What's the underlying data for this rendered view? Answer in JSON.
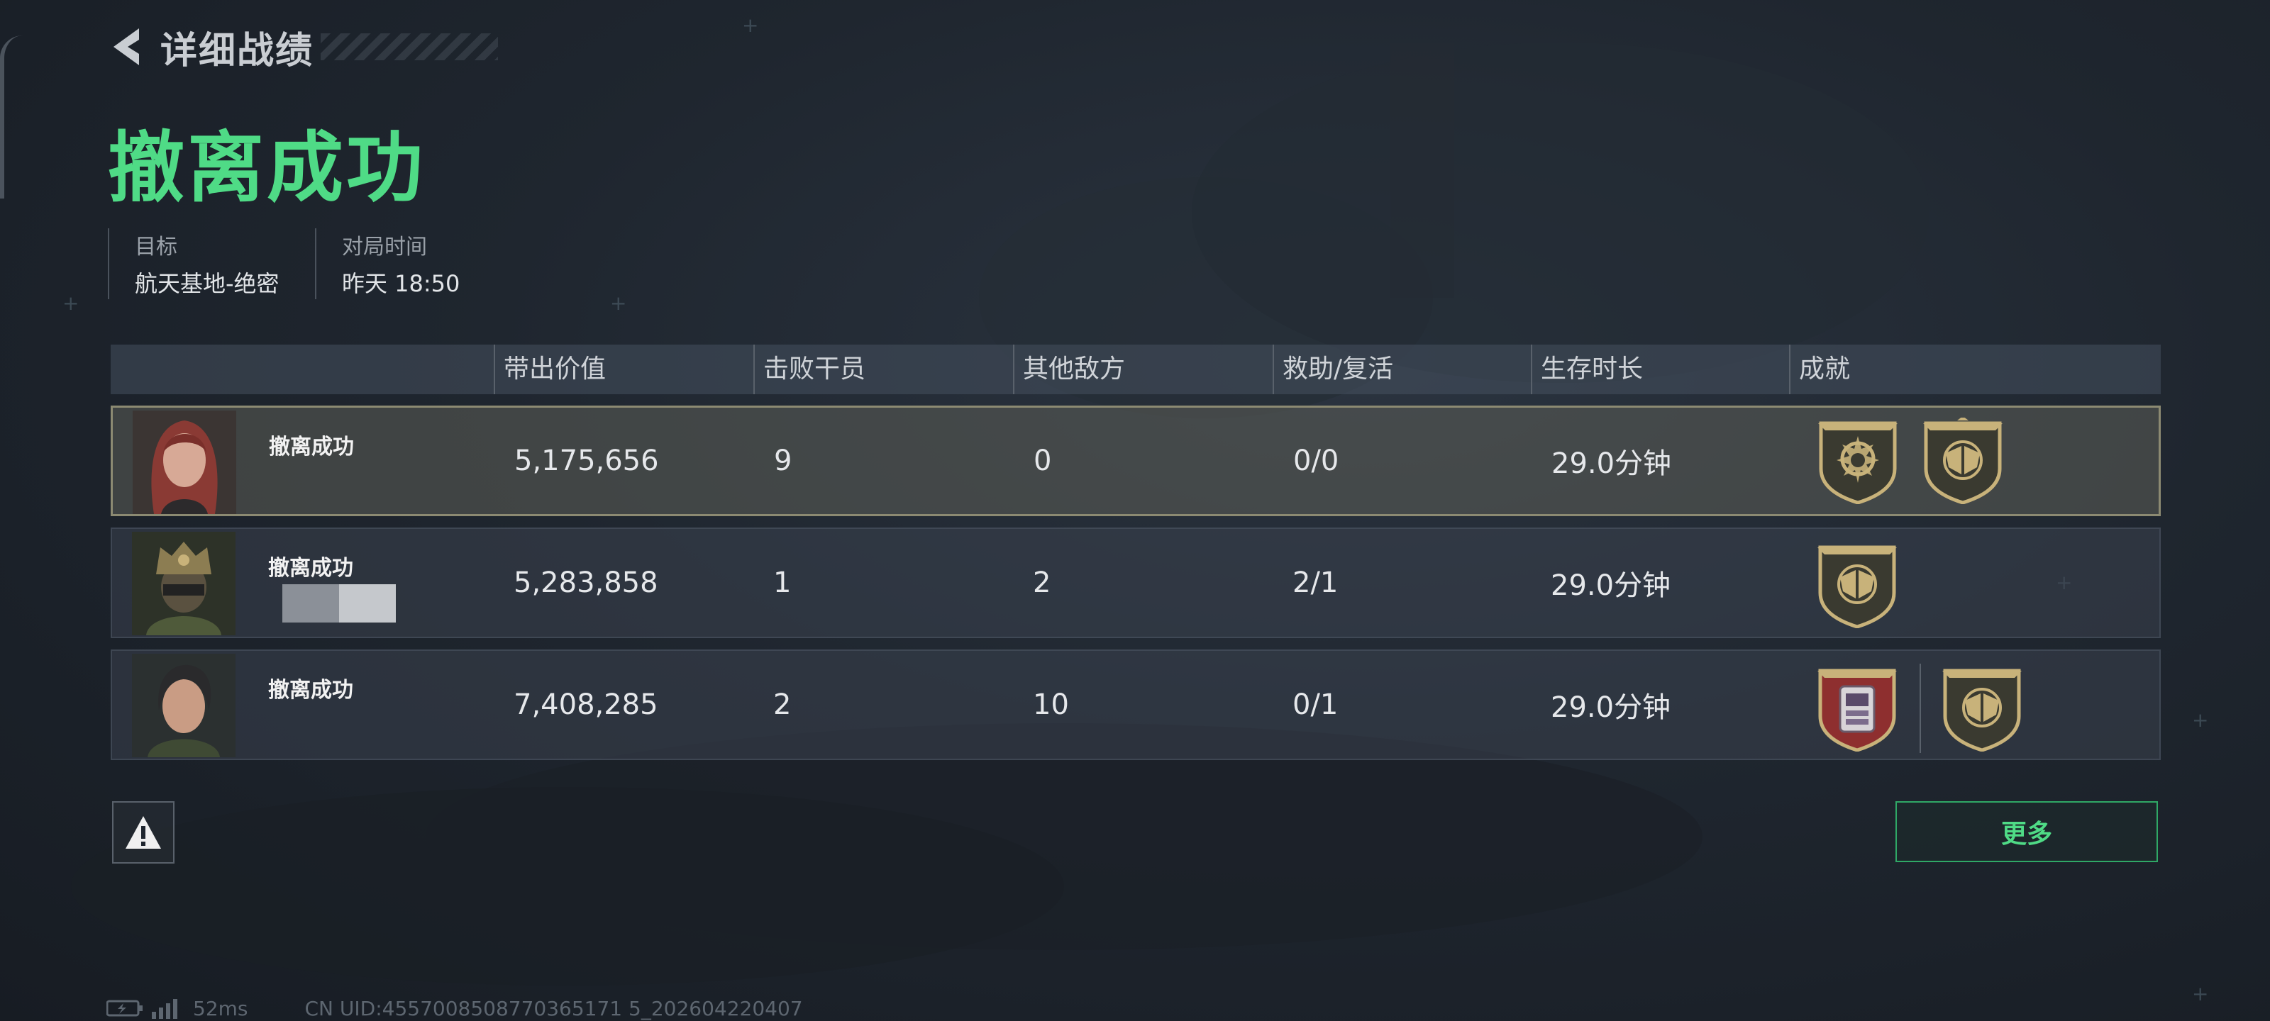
{
  "header": {
    "title": "详细战绩"
  },
  "result": {
    "title": "撤离成功"
  },
  "meta": [
    {
      "label": "目标",
      "value": "航天基地-绝密"
    },
    {
      "label": "对局时间",
      "value": "昨天 18:50"
    }
  ],
  "table": {
    "headers": [
      "带出价值",
      "击败干员",
      "其他敌方",
      "救助/复活",
      "生存时长",
      "成就"
    ],
    "rows": [
      {
        "status": "撤离成功",
        "value": "5,175,656",
        "kills": "9",
        "others": "0",
        "rescue": "0/0",
        "time": "29.0分钟",
        "badges": [
          "sun-crest-badge-icon",
          "wings-crest-badge-icon"
        ],
        "highlight": true
      },
      {
        "status": "撤离成功",
        "value": "5,283,858",
        "kills": "1",
        "others": "2",
        "rescue": "2/1",
        "time": "29.0分钟",
        "badges": [
          "wings-crest-badge-icon"
        ],
        "highlight": false
      },
      {
        "status": "撤离成功",
        "value": "7,408,285",
        "kills": "2",
        "others": "10",
        "rescue": "0/1",
        "time": "29.0分钟",
        "badges": [
          "device-crest-badge-icon",
          "wings-crest-badge-icon"
        ],
        "highlight": false
      }
    ]
  },
  "buttons": {
    "more": "更多"
  },
  "footer": {
    "ping": "52ms",
    "uid": "CN UID:4557008508770365171 5_202604220407"
  },
  "colors": {
    "accent": "#4fdb86",
    "gold": "#c8b27a",
    "red_badge": "#8e2f2f"
  }
}
